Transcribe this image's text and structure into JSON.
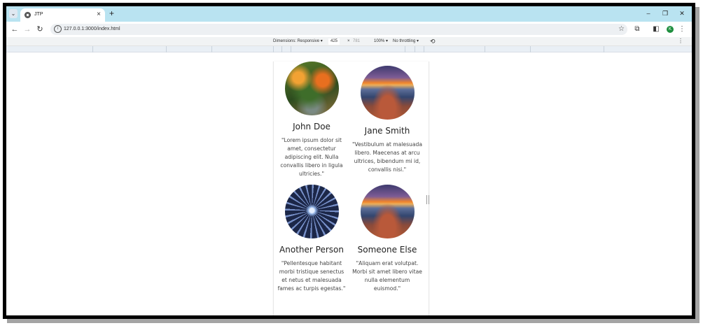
{
  "browser": {
    "tab": {
      "title": "JTP"
    },
    "address": {
      "url": "127.0.0.1:3000/index.html"
    },
    "profile_initial": "K"
  },
  "devtools": {
    "dimensions_label": "Dimensions: Responsive ▾",
    "width": "425",
    "times": "×",
    "height": "781",
    "zoom": "100% ▾",
    "throttling": "No throttling ▾"
  },
  "testimonials": [
    {
      "name": "John Doe",
      "quote": "\"Lorem ipsum dolor sit amet, consectetur adipiscing elit. Nulla convallis libero in ligula ultricies.\""
    },
    {
      "name": "Jane Smith",
      "quote": "\"Vestibulum at malesuada libero. Maecenas at arcu ultrices, bibendum mi id, convallis nisi.\""
    },
    {
      "name": "Another Person",
      "quote": "\"Pellentesque habitant morbi tristique senectus et netus et malesuada fames ac turpis egestas.\""
    },
    {
      "name": "Someone Else",
      "quote": "\"Aliquam erat volutpat. Morbi sit amet libero vitae nulla elementum euismod.\""
    }
  ],
  "icons": {
    "tab_search": "chevron-down-icon",
    "favicon": "globe-icon",
    "close": "close-icon",
    "new_tab": "plus-icon",
    "back": "back-arrow-icon",
    "forward": "forward-arrow-icon",
    "reload": "reload-icon",
    "site_info": "info-icon",
    "bookmark": "star-icon",
    "extensions": "puzzle-icon",
    "side_panel": "side-panel-icon",
    "menu": "kebab-menu-icon",
    "rotate": "rotate-icon"
  },
  "colors": {
    "tabstrip": "#b9e3f1",
    "profile": "#1e8e3e"
  }
}
